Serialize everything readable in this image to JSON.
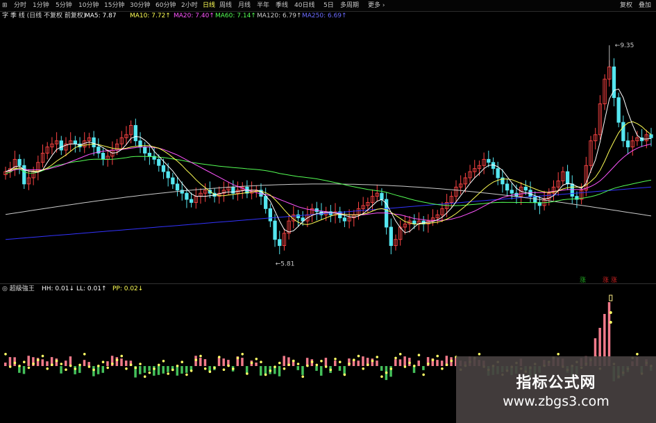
{
  "toolbar": {
    "tabs": [
      {
        "label": "⊞"
      },
      {
        "label": "分时"
      },
      {
        "label": "1分钟"
      },
      {
        "label": "5分钟"
      },
      {
        "label": "10分钟"
      },
      {
        "label": "15分钟"
      },
      {
        "label": "30分钟"
      },
      {
        "label": "60分钟"
      },
      {
        "label": "2小时"
      },
      {
        "label": "日线"
      },
      {
        "label": "周线"
      },
      {
        "label": "月线"
      },
      {
        "label": "半年"
      },
      {
        "label": "季线"
      },
      {
        "label": "40日线"
      },
      {
        "label": "5日"
      },
      {
        "label": "多周期"
      },
      {
        "label": "更多 ›"
      }
    ],
    "active_tab": "日线",
    "right_buttons": [
      {
        "label": "复权"
      },
      {
        "label": "叠加"
      }
    ]
  },
  "main_legend": {
    "title": "字 季 线 (日线 不复权 前复权)",
    "items": [
      {
        "label": "MA5: 7.87",
        "color": "#ffffff"
      },
      {
        "label": "MA10: 7.72↑",
        "color": "#ffff55"
      },
      {
        "label": "MA20: 7.40↑",
        "color": "#ff55ff"
      },
      {
        "label": "MA60: 7.14↑",
        "color": "#55ff55"
      },
      {
        "label": "MA120: 6.79↑",
        "color": "#cccccc"
      },
      {
        "label": "MA250: 6.69↑",
        "color": "#5555ff"
      }
    ]
  },
  "annotations": {
    "high": "9.35",
    "low": "5.81"
  },
  "markers": [
    {
      "label": "涨",
      "color": "#22aa22"
    },
    {
      "label": "涨 涨",
      "color": "#cc2222"
    }
  ],
  "sub_legend": {
    "title": "超級強王",
    "items": [
      {
        "label": "HH: 0.01↓",
        "color": "#ffffff"
      },
      {
        "label": "LL: 0.01↑",
        "color": "#ffffff"
      },
      {
        "label": "PP: 0.02↓",
        "color": "#ffff55"
      }
    ]
  },
  "watermark": {
    "line1": "指标公式网",
    "line2": "www.zbgs3.com"
  },
  "chart_data": {
    "type": "candlestick",
    "colors": {
      "up": "#ff4444",
      "down": "#55e6f0",
      "ma5": "#ffffff",
      "ma10": "#ffff55",
      "ma20": "#ff55ff",
      "ma60": "#55ff55",
      "ma120": "#cccccc",
      "ma250": "#3333ff"
    },
    "close": [
      7.3,
      7.35,
      7.5,
      7.4,
      7.1,
      7.2,
      7.3,
      7.45,
      7.6,
      7.7,
      7.75,
      7.8,
      7.65,
      7.75,
      7.8,
      7.75,
      7.7,
      7.8,
      7.85,
      7.7,
      7.6,
      7.5,
      7.55,
      7.65,
      7.75,
      7.85,
      7.9,
      8.05,
      7.8,
      7.7,
      7.6,
      7.55,
      7.5,
      7.4,
      7.3,
      7.2,
      7.1,
      7.0,
      6.95,
      6.85,
      6.8,
      6.9,
      6.95,
      7.0,
      6.95,
      6.9,
      6.95,
      7.0,
      7.05,
      6.95,
      7.0,
      7.05,
      6.95,
      7.0,
      7.0,
      6.9,
      6.7,
      6.5,
      6.2,
      6.1,
      6.3,
      6.5,
      6.6,
      6.55,
      6.5,
      6.6,
      6.7,
      6.65,
      6.6,
      6.65,
      6.6,
      6.65,
      6.55,
      6.5,
      6.55,
      6.6,
      6.7,
      6.75,
      6.8,
      6.9,
      6.95,
      6.85,
      6.4,
      6.1,
      6.2,
      6.4,
      6.45,
      6.5,
      6.45,
      6.5,
      6.45,
      6.5,
      6.55,
      6.6,
      6.7,
      6.8,
      6.9,
      7.05,
      7.1,
      7.2,
      7.3,
      7.35,
      7.4,
      7.5,
      7.45,
      7.35,
      7.2,
      7.1,
      7.0,
      6.95,
      6.9,
      7.05,
      7.0,
      6.9,
      6.8,
      6.75,
      6.85,
      6.95,
      7.05,
      7.15,
      7.3,
      7.1,
      6.9,
      6.85,
      7.0,
      7.4,
      7.8,
      7.9,
      8.4,
      8.8,
      9.0,
      8.5,
      8.1,
      7.8,
      7.7,
      7.8,
      7.85,
      7.8,
      7.9,
      7.85
    ],
    "ma5": [
      7.3,
      7.33,
      7.38,
      7.39,
      7.33,
      7.31,
      7.3,
      7.29,
      7.33,
      7.45,
      7.56,
      7.66,
      7.7,
      7.73,
      7.75,
      7.75,
      7.73,
      7.76,
      7.78,
      7.76,
      7.73,
      7.69,
      7.64,
      7.6,
      7.61,
      7.66,
      7.74,
      7.84,
      7.87,
      7.86,
      7.81,
      7.74,
      7.63,
      7.55,
      7.47,
      7.39,
      7.31,
      7.21,
      7.11,
      7.02,
      6.94,
      6.9,
      6.9,
      6.9,
      6.91,
      6.92,
      6.94,
      6.96,
      6.97,
      6.97,
      6.98,
      6.99,
      7.0,
      7.0,
      7.0,
      6.98,
      6.91,
      6.82,
      6.66,
      6.5,
      6.36,
      6.32,
      6.34,
      6.41,
      6.49,
      6.55,
      6.59,
      6.62,
      6.63,
      6.64,
      6.64,
      6.63,
      6.61,
      6.59,
      6.57,
      6.56,
      6.58,
      6.62,
      6.68,
      6.75,
      6.82,
      6.85,
      6.78,
      6.64,
      6.5,
      6.39,
      6.31,
      6.33,
      6.4,
      6.46,
      6.47,
      6.48,
      6.49,
      6.52,
      6.56,
      6.63,
      6.71,
      6.81,
      6.91,
      7.01,
      7.11,
      7.2,
      7.27,
      7.35,
      7.4,
      7.41,
      7.38,
      7.32,
      7.22,
      7.12,
      7.03,
      6.98,
      6.96,
      6.94,
      6.91,
      6.88,
      6.86,
      6.87,
      6.91,
      6.99,
      7.08,
      7.11,
      7.1,
      7.06,
      7.03,
      7.11,
      7.31,
      7.49,
      7.78,
      8.14,
      8.48,
      8.62,
      8.64,
      8.5,
      8.26,
      8.06,
      7.89,
      7.83,
      7.83,
      7.84
    ],
    "ma10": [
      7.3,
      7.32,
      7.35,
      7.36,
      7.33,
      7.31,
      7.31,
      7.31,
      7.33,
      7.36,
      7.41,
      7.47,
      7.52,
      7.57,
      7.63,
      7.69,
      7.72,
      7.73,
      7.74,
      7.75,
      7.74,
      7.72,
      7.7,
      7.68,
      7.67,
      7.67,
      7.68,
      7.7,
      7.71,
      7.72,
      7.72,
      7.72,
      7.7,
      7.68,
      7.64,
      7.59,
      7.53,
      7.47,
      7.4,
      7.32,
      7.25,
      7.17,
      7.1,
      7.04,
      6.98,
      6.93,
      6.91,
      6.91,
      6.92,
      6.93,
      6.94,
      6.95,
      6.96,
      6.97,
      6.98,
      6.98,
      6.96,
      6.92,
      6.85,
      6.77,
      6.68,
      6.6,
      6.53,
      6.48,
      6.45,
      6.44,
      6.46,
      6.49,
      6.52,
      6.55,
      6.58,
      6.6,
      6.61,
      6.61,
      6.6,
      6.6,
      6.6,
      6.61,
      6.63,
      6.66,
      6.69,
      6.7,
      6.68,
      6.64,
      6.59,
      6.54,
      6.49,
      6.47,
      6.45,
      6.45,
      6.46,
      6.46,
      6.47,
      6.48,
      6.5,
      6.53,
      6.57,
      6.62,
      6.68,
      6.74,
      6.81,
      6.88,
      6.95,
      7.02,
      7.08,
      7.13,
      7.16,
      7.18,
      7.18,
      7.17,
      7.14,
      7.11,
      7.08,
      7.05,
      7.02,
      6.99,
      6.97,
      6.96,
      6.97,
      6.99,
      7.02,
      7.04,
      7.05,
      7.05,
      7.05,
      7.08,
      7.14,
      7.21,
      7.32,
      7.47,
      7.64,
      7.79,
      7.93,
      8.03,
      8.09,
      8.11,
      8.08,
      8.03,
      7.96,
      7.9
    ],
    "ma20": [
      7.3,
      7.31,
      7.33,
      7.34,
      7.34,
      7.33,
      7.33,
      7.33,
      7.33,
      7.34,
      7.36,
      7.38,
      7.4,
      7.43,
      7.46,
      7.49,
      7.52,
      7.55,
      7.58,
      7.6,
      7.62,
      7.63,
      7.64,
      7.65,
      7.65,
      7.66,
      7.67,
      7.68,
      7.69,
      7.7,
      7.7,
      7.7,
      7.69,
      7.68,
      7.66,
      7.63,
      7.6,
      7.57,
      7.53,
      7.49,
      7.45,
      7.41,
      7.37,
      7.33,
      7.29,
      7.25,
      7.21,
      7.17,
      7.13,
      7.09,
      7.06,
      7.03,
      7.0,
      6.98,
      6.96,
      6.94,
      6.93,
      6.91,
      6.88,
      6.85,
      6.82,
      6.79,
      6.76,
      6.73,
      6.71,
      6.69,
      6.68,
      6.67,
      6.66,
      6.65,
      6.64,
      6.63,
      6.62,
      6.61,
      6.6,
      6.6,
      6.6,
      6.6,
      6.61,
      6.62,
      6.63,
      6.63,
      6.63,
      6.62,
      6.61,
      6.6,
      6.58,
      6.56,
      6.54,
      6.53,
      6.52,
      6.51,
      6.51,
      6.51,
      6.51,
      6.52,
      6.53,
      6.55,
      6.57,
      6.6,
      6.63,
      6.66,
      6.7,
      6.74,
      6.78,
      6.82,
      6.85,
      6.88,
      6.9,
      6.92,
      6.93,
      6.94,
      6.95,
      6.96,
      6.96,
      6.96,
      6.96,
      6.97,
      6.98,
      6.99,
      7.0,
      7.01,
      7.01,
      7.01,
      7.01,
      7.03,
      7.06,
      7.1,
      7.15,
      7.22,
      7.3,
      7.38,
      7.46,
      7.53,
      7.59,
      7.64,
      7.68,
      7.71,
      7.73,
      7.75
    ]
  }
}
